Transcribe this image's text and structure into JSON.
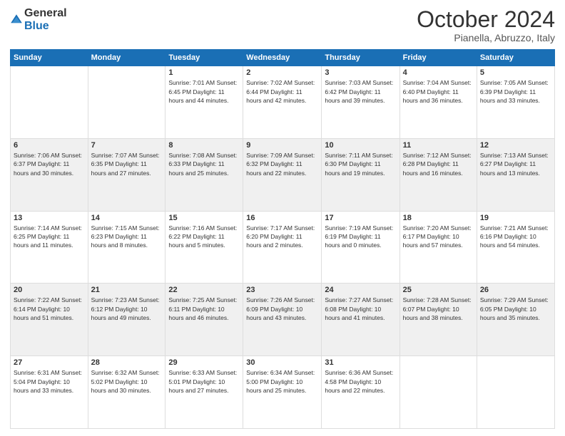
{
  "header": {
    "logo_general": "General",
    "logo_blue": "Blue",
    "month": "October 2024",
    "location": "Pianella, Abruzzo, Italy"
  },
  "weekdays": [
    "Sunday",
    "Monday",
    "Tuesday",
    "Wednesday",
    "Thursday",
    "Friday",
    "Saturday"
  ],
  "weeks": [
    [
      {
        "day": "",
        "details": ""
      },
      {
        "day": "",
        "details": ""
      },
      {
        "day": "1",
        "details": "Sunrise: 7:01 AM\nSunset: 6:45 PM\nDaylight: 11 hours and 44 minutes."
      },
      {
        "day": "2",
        "details": "Sunrise: 7:02 AM\nSunset: 6:44 PM\nDaylight: 11 hours and 42 minutes."
      },
      {
        "day": "3",
        "details": "Sunrise: 7:03 AM\nSunset: 6:42 PM\nDaylight: 11 hours and 39 minutes."
      },
      {
        "day": "4",
        "details": "Sunrise: 7:04 AM\nSunset: 6:40 PM\nDaylight: 11 hours and 36 minutes."
      },
      {
        "day": "5",
        "details": "Sunrise: 7:05 AM\nSunset: 6:39 PM\nDaylight: 11 hours and 33 minutes."
      }
    ],
    [
      {
        "day": "6",
        "details": "Sunrise: 7:06 AM\nSunset: 6:37 PM\nDaylight: 11 hours and 30 minutes."
      },
      {
        "day": "7",
        "details": "Sunrise: 7:07 AM\nSunset: 6:35 PM\nDaylight: 11 hours and 27 minutes."
      },
      {
        "day": "8",
        "details": "Sunrise: 7:08 AM\nSunset: 6:33 PM\nDaylight: 11 hours and 25 minutes."
      },
      {
        "day": "9",
        "details": "Sunrise: 7:09 AM\nSunset: 6:32 PM\nDaylight: 11 hours and 22 minutes."
      },
      {
        "day": "10",
        "details": "Sunrise: 7:11 AM\nSunset: 6:30 PM\nDaylight: 11 hours and 19 minutes."
      },
      {
        "day": "11",
        "details": "Sunrise: 7:12 AM\nSunset: 6:28 PM\nDaylight: 11 hours and 16 minutes."
      },
      {
        "day": "12",
        "details": "Sunrise: 7:13 AM\nSunset: 6:27 PM\nDaylight: 11 hours and 13 minutes."
      }
    ],
    [
      {
        "day": "13",
        "details": "Sunrise: 7:14 AM\nSunset: 6:25 PM\nDaylight: 11 hours and 11 minutes."
      },
      {
        "day": "14",
        "details": "Sunrise: 7:15 AM\nSunset: 6:23 PM\nDaylight: 11 hours and 8 minutes."
      },
      {
        "day": "15",
        "details": "Sunrise: 7:16 AM\nSunset: 6:22 PM\nDaylight: 11 hours and 5 minutes."
      },
      {
        "day": "16",
        "details": "Sunrise: 7:17 AM\nSunset: 6:20 PM\nDaylight: 11 hours and 2 minutes."
      },
      {
        "day": "17",
        "details": "Sunrise: 7:19 AM\nSunset: 6:19 PM\nDaylight: 11 hours and 0 minutes."
      },
      {
        "day": "18",
        "details": "Sunrise: 7:20 AM\nSunset: 6:17 PM\nDaylight: 10 hours and 57 minutes."
      },
      {
        "day": "19",
        "details": "Sunrise: 7:21 AM\nSunset: 6:16 PM\nDaylight: 10 hours and 54 minutes."
      }
    ],
    [
      {
        "day": "20",
        "details": "Sunrise: 7:22 AM\nSunset: 6:14 PM\nDaylight: 10 hours and 51 minutes."
      },
      {
        "day": "21",
        "details": "Sunrise: 7:23 AM\nSunset: 6:12 PM\nDaylight: 10 hours and 49 minutes."
      },
      {
        "day": "22",
        "details": "Sunrise: 7:25 AM\nSunset: 6:11 PM\nDaylight: 10 hours and 46 minutes."
      },
      {
        "day": "23",
        "details": "Sunrise: 7:26 AM\nSunset: 6:09 PM\nDaylight: 10 hours and 43 minutes."
      },
      {
        "day": "24",
        "details": "Sunrise: 7:27 AM\nSunset: 6:08 PM\nDaylight: 10 hours and 41 minutes."
      },
      {
        "day": "25",
        "details": "Sunrise: 7:28 AM\nSunset: 6:07 PM\nDaylight: 10 hours and 38 minutes."
      },
      {
        "day": "26",
        "details": "Sunrise: 7:29 AM\nSunset: 6:05 PM\nDaylight: 10 hours and 35 minutes."
      }
    ],
    [
      {
        "day": "27",
        "details": "Sunrise: 6:31 AM\nSunset: 5:04 PM\nDaylight: 10 hours and 33 minutes."
      },
      {
        "day": "28",
        "details": "Sunrise: 6:32 AM\nSunset: 5:02 PM\nDaylight: 10 hours and 30 minutes."
      },
      {
        "day": "29",
        "details": "Sunrise: 6:33 AM\nSunset: 5:01 PM\nDaylight: 10 hours and 27 minutes."
      },
      {
        "day": "30",
        "details": "Sunrise: 6:34 AM\nSunset: 5:00 PM\nDaylight: 10 hours and 25 minutes."
      },
      {
        "day": "31",
        "details": "Sunrise: 6:36 AM\nSunset: 4:58 PM\nDaylight: 10 hours and 22 minutes."
      },
      {
        "day": "",
        "details": ""
      },
      {
        "day": "",
        "details": ""
      }
    ]
  ]
}
